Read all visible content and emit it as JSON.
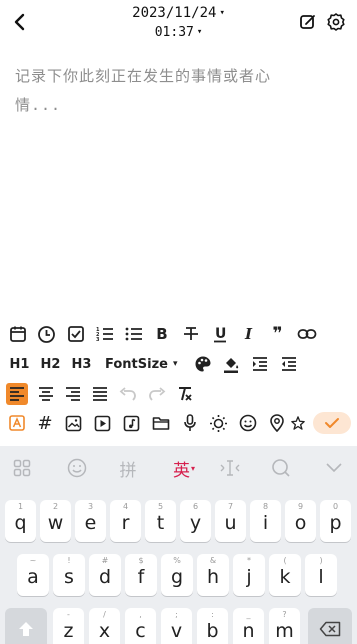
{
  "header": {
    "date": "2023/11/24",
    "time": "01:37",
    "caret": "▾",
    "back_icon": "chevron-left-icon",
    "edit_icon": "edit-icon",
    "settings_icon": "gear-icon"
  },
  "editor": {
    "placeholder": "记录下你此刻正在发生的事情或者心情..."
  },
  "toolbar": {
    "h1": "H1",
    "h2": "H2",
    "h3": "H3",
    "fontsize": "FontSize",
    "fontsize_caret": "▾",
    "bold": "B",
    "italic": "I",
    "underline": "U",
    "quote": "❞",
    "hash": "#",
    "accent": "#f0892b"
  },
  "keyboard": {
    "pinyin_label": "拼",
    "english_label": "英",
    "english_caret": "▾",
    "english_color": "#d6204e",
    "row1": [
      {
        "hint": "1",
        "ch": "q"
      },
      {
        "hint": "2",
        "ch": "w"
      },
      {
        "hint": "3",
        "ch": "e"
      },
      {
        "hint": "4",
        "ch": "r"
      },
      {
        "hint": "5",
        "ch": "t"
      },
      {
        "hint": "6",
        "ch": "y"
      },
      {
        "hint": "7",
        "ch": "u"
      },
      {
        "hint": "8",
        "ch": "i"
      },
      {
        "hint": "9",
        "ch": "o"
      },
      {
        "hint": "0",
        "ch": "p"
      }
    ],
    "row2": [
      {
        "hint": "~",
        "ch": "a"
      },
      {
        "hint": "!",
        "ch": "s"
      },
      {
        "hint": "#",
        "ch": "d"
      },
      {
        "hint": "$",
        "ch": "f"
      },
      {
        "hint": "%",
        "ch": "g"
      },
      {
        "hint": "&",
        "ch": "h"
      },
      {
        "hint": "*",
        "ch": "j"
      },
      {
        "hint": "(",
        "ch": "k"
      },
      {
        "hint": ")",
        "ch": "l"
      }
    ],
    "row3": [
      {
        "hint": "-",
        "ch": "z"
      },
      {
        "hint": "/",
        "ch": "x"
      },
      {
        "hint": ",",
        "ch": "c"
      },
      {
        "hint": ";",
        "ch": "v"
      },
      {
        "hint": ":",
        "ch": "b"
      },
      {
        "hint": "_",
        "ch": "n"
      },
      {
        "hint": "?",
        "ch": "m"
      }
    ]
  }
}
